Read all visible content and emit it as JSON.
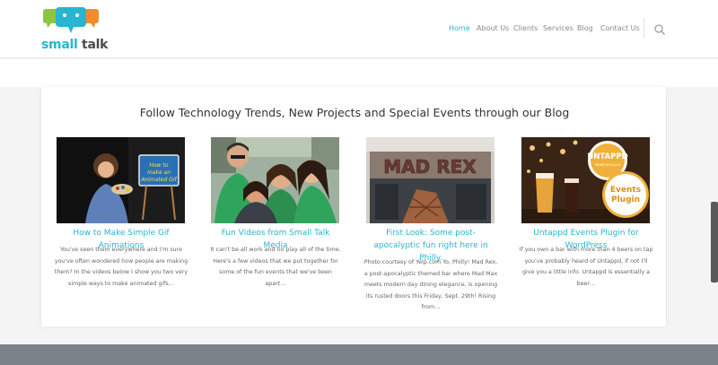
{
  "brand": {
    "word1": "small",
    "word2": "talk"
  },
  "nav": {
    "items": [
      {
        "label": "Home",
        "active": true
      },
      {
        "label": "About Us",
        "active": false
      },
      {
        "label": "Clients",
        "active": false
      },
      {
        "label": "Services",
        "active": false
      },
      {
        "label": "Blog",
        "active": false
      },
      {
        "label": "Contact Us",
        "active": false
      }
    ],
    "search_icon": "search-icon"
  },
  "blog": {
    "heading": "Follow Technology Trends, New Projects and Special Events through our Blog",
    "posts": [
      {
        "title": "How to Make Simple Gif Animations",
        "excerpt": "You've seen them everywhere and I'm sure you've often wondered how people are making them? In the videos below I show you two very simple ways to make animated gifs…",
        "image_text": "How to make an Animated Gif"
      },
      {
        "title": "Fun Videos from Small Talk Media",
        "excerpt": "It can't be all work and no play all of the time. Here's a few videos that we put together for some of the fun events that we've been apart…",
        "image_text": ""
      },
      {
        "title": "First Look: Some post-apocalyptic fun right here in Philly.",
        "excerpt": "Photo courtesy of Yelp.com Yo, Philly! Mad Rex, a post-apocalyptic themed bar where Mad Max meets modern day dining elegance, is opening its rusted doors this Friday, Sept. 29th! Rising from…",
        "image_text": "MAD REX"
      },
      {
        "title": "Untappd Events Plugin for WordPress",
        "excerpt": "If you own a bar with more than 4 beers on tap you've probably heard of Untappd, if not I'll give you a little info. Untappd is essentially a beer…",
        "image_text": "UNTAPPD",
        "image_subtext": "DRINK SOCIALLY",
        "image_badge": "Events Plugin"
      }
    ]
  },
  "colors": {
    "accent": "#29b4cf",
    "footer": "#7d838a",
    "text": "#333333"
  }
}
